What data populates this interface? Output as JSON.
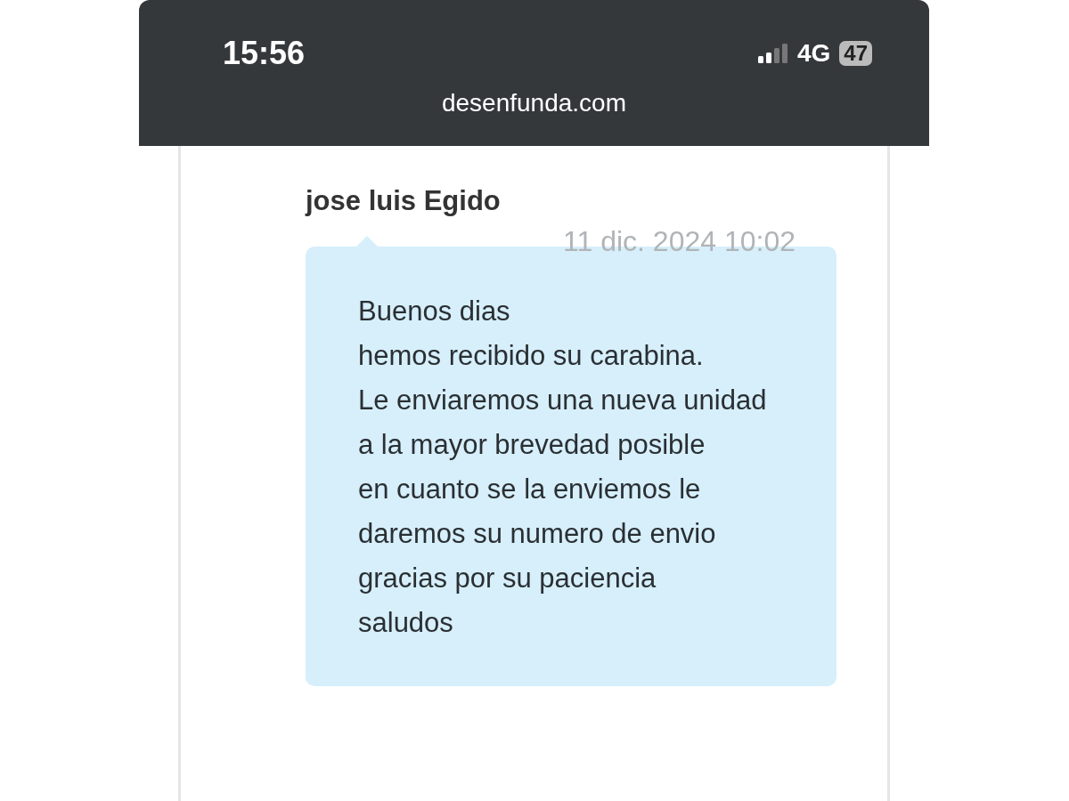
{
  "status_bar": {
    "time": "15:56",
    "network": "4G",
    "battery": "47"
  },
  "address_bar": {
    "domain": "desenfunda.com"
  },
  "message": {
    "author": "jose luis Egido",
    "date": "11 dic. 2024 10:02",
    "text": "Buenos dias\nhemos recibido su carabina.\nLe enviaremos una nueva unidad a la mayor brevedad posible\nen cuanto se la enviemos le daremos su numero de envio\ngracias por su paciencia\nsaludos"
  }
}
